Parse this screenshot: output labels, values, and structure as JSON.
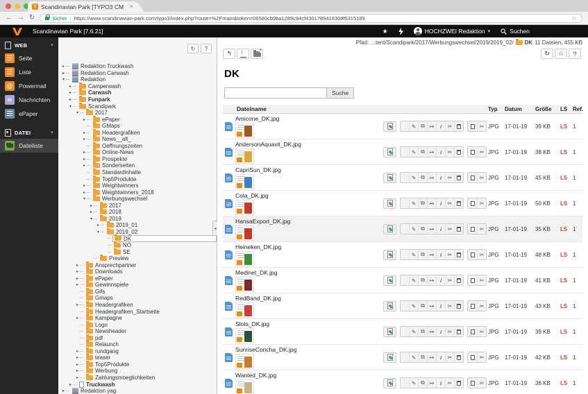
{
  "browser": {
    "tab_title": "Scandinavian Park [TYPO3 CM",
    "security_label": "Sicher",
    "url": "https://www.scandinavian-park.com/typo3/index.php?route=%2Fmain&token=06580cb9ba1289c94cf4301789416308f5315189"
  },
  "topbar": {
    "site_title": "Scandinavian Park [7.6.21]",
    "username": "HOCHZWEI Redaktion",
    "search_label": "Suchen"
  },
  "module_menu": {
    "web_label": "WEB",
    "datei_label": "DATEI",
    "web_items": [
      {
        "label": "Seite",
        "icon": "page-icon",
        "color": "#f48620"
      },
      {
        "label": "Liste",
        "icon": "list-icon",
        "color": "#f48620"
      },
      {
        "label": "Powermail",
        "icon": "at-icon",
        "color": "#f48620"
      },
      {
        "label": "Nachrichten",
        "icon": "news-icon",
        "color": "#a6a7d4"
      },
      {
        "label": "ePaper",
        "icon": "epaper-icon",
        "color": "#6c87a0"
      }
    ],
    "datei_items": [
      {
        "label": "Dateiliste",
        "icon": "filelist-icon",
        "color": "#79a548",
        "active": true
      }
    ]
  },
  "tree": {
    "items": [
      {
        "label": "Redaktion Truckwash",
        "level": 0,
        "arrow": "closed",
        "icon": "storage"
      },
      {
        "label": "Redaktion Carwash",
        "level": 0,
        "arrow": "closed",
        "icon": "storage"
      },
      {
        "label": "Redaktion",
        "level": 0,
        "arrow": "open",
        "icon": "storage"
      },
      {
        "label": "Camperwash",
        "level": 1,
        "arrow": "closed",
        "icon": "folder"
      },
      {
        "label": "Carwash",
        "level": 1,
        "arrow": "closed",
        "icon": "folder",
        "bold": true
      },
      {
        "label": "Funpark",
        "level": 1,
        "arrow": "closed",
        "icon": "folder",
        "bold": true
      },
      {
        "label": "Scandipark",
        "level": 1,
        "arrow": "open",
        "icon": "folder"
      },
      {
        "label": "2017",
        "level": 2,
        "arrow": "open",
        "icon": "folder"
      },
      {
        "label": "ePaper",
        "level": 3,
        "arrow": "closed",
        "icon": "folder"
      },
      {
        "label": "GMaps",
        "level": 3,
        "icon": "folder"
      },
      {
        "label": "Headergrafiken",
        "level": 3,
        "arrow": "closed",
        "icon": "folder"
      },
      {
        "label": "News__alt_",
        "level": 3,
        "arrow": "closed",
        "icon": "folder"
      },
      {
        "label": "Oeffnungszeiten",
        "level": 3,
        "icon": "folder"
      },
      {
        "label": "Online-News",
        "level": 3,
        "arrow": "closed",
        "icon": "folder"
      },
      {
        "label": "Prospekte",
        "level": 3,
        "arrow": "closed",
        "icon": "folder"
      },
      {
        "label": "Sonderseiten",
        "level": 3,
        "arrow": "closed",
        "icon": "folder"
      },
      {
        "label": "Standardinhalte",
        "level": 3,
        "icon": "folder"
      },
      {
        "label": "Top5Produkte",
        "level": 3,
        "icon": "folder"
      },
      {
        "label": "Weightwinners",
        "level": 3,
        "arrow": "closed",
        "icon": "folder"
      },
      {
        "label": "Weightwinners_2018",
        "level": 3,
        "arrow": "closed",
        "icon": "folder"
      },
      {
        "label": "Werbungswechsel",
        "level": 3,
        "arrow": "open",
        "icon": "folder"
      },
      {
        "label": "2017",
        "level": 4,
        "arrow": "closed",
        "icon": "folder"
      },
      {
        "label": "2018",
        "level": 4,
        "arrow": "closed",
        "icon": "folder"
      },
      {
        "label": "2019",
        "level": 4,
        "arrow": "open",
        "icon": "folder"
      },
      {
        "label": "2019_01",
        "level": 5,
        "arrow": "closed",
        "icon": "folder"
      },
      {
        "label": "2019_02",
        "level": 5,
        "arrow": "open",
        "icon": "folder"
      },
      {
        "label": "DK",
        "level": 6,
        "icon": "folder",
        "selected": true
      },
      {
        "label": "NO",
        "level": 6,
        "icon": "folder"
      },
      {
        "label": "SE",
        "level": 6,
        "icon": "folder"
      },
      {
        "label": "Preview",
        "level": 4,
        "icon": "folder"
      },
      {
        "label": "Ansprechpartner",
        "level": 2,
        "arrow": "closed",
        "icon": "folder"
      },
      {
        "label": "Downloads",
        "level": 2,
        "arrow": "closed",
        "icon": "folder"
      },
      {
        "label": "ePaper",
        "level": 2,
        "arrow": "closed",
        "icon": "folder"
      },
      {
        "label": "Gewinnspiele",
        "level": 2,
        "arrow": "closed",
        "icon": "folder"
      },
      {
        "label": "Gifs",
        "level": 2,
        "icon": "folder"
      },
      {
        "label": "Gmaps",
        "level": 2,
        "icon": "folder"
      },
      {
        "label": "Headergrafiken",
        "level": 2,
        "arrow": "closed",
        "icon": "folder"
      },
      {
        "label": "Headergrafiken_Startseite",
        "level": 2,
        "icon": "folder"
      },
      {
        "label": "Kampagne",
        "level": 2,
        "arrow": "closed",
        "icon": "folder"
      },
      {
        "label": "Logo",
        "level": 2,
        "icon": "folder"
      },
      {
        "label": "Newsheader",
        "level": 2,
        "icon": "folder"
      },
      {
        "label": "pdf",
        "level": 2,
        "icon": "folder"
      },
      {
        "label": "Relaunch",
        "level": 2,
        "icon": "folder"
      },
      {
        "label": "rundgang",
        "level": 2,
        "arrow": "closed",
        "icon": "folder"
      },
      {
        "label": "teaser",
        "level": 2,
        "arrow": "closed",
        "icon": "folder"
      },
      {
        "label": "Top5Produkte",
        "level": 2,
        "arrow": "closed",
        "icon": "folder"
      },
      {
        "label": "Werbung",
        "level": 2,
        "arrow": "closed",
        "icon": "folder"
      },
      {
        "label": "Zahlungsmoeglichkeiten",
        "level": 2,
        "arrow": "closed",
        "icon": "folder"
      },
      {
        "label": "Truckwash",
        "level": 1,
        "arrow": "closed",
        "icon": "page",
        "bold": true
      },
      {
        "label": "Redaktion yag",
        "level": 0,
        "arrow": "closed",
        "icon": "storage"
      }
    ]
  },
  "docheader": {
    "path_label": "Pfad:",
    "path_value": "...tent/Scandipark/2017/Werbungswechsel/2019/2019_02/",
    "folder_name": "DK",
    "folder_info": "11 Dateien, 455 KB"
  },
  "content": {
    "title": "DK",
    "search_button": "Suche",
    "columns": {
      "name": "Dateiname",
      "type": "Typ",
      "date": "Datum",
      "size": "Größe",
      "ls": "LS",
      "ref": "Ref."
    },
    "row_action_icons": [
      "view",
      "edit",
      "replace",
      "move",
      "info",
      "cut",
      "delete",
      "copy",
      "cut"
    ],
    "files": [
      {
        "name": "Amicone_DK.jpg",
        "type": "JPG",
        "date": "17-01-19",
        "size": "39 KB",
        "ls": "LS",
        "ref": "1",
        "accent": "#9a5a28"
      },
      {
        "name": "AndersonAquavit_DK.jpg",
        "type": "JPG",
        "date": "17-01-19",
        "size": "38 KB",
        "ls": "LS",
        "ref": "1",
        "accent": "#d9a93f"
      },
      {
        "name": "CapriSun_DK.jpg",
        "type": "JPG",
        "date": "17-01-19",
        "size": "45 KB",
        "ls": "LS",
        "ref": "1",
        "accent": "#3f7fc4"
      },
      {
        "name": "Cola_DK.jpg",
        "type": "JPG",
        "date": "17-01-19",
        "size": "50 KB",
        "ls": "LS",
        "ref": "1",
        "accent": "#c43b2a"
      },
      {
        "name": "HansaExport_DK.jpg",
        "type": "JPG",
        "date": "17-01-19",
        "size": "35 KB",
        "ls": "LS",
        "ref": "1",
        "accent": "#c0392b",
        "highlighted": true
      },
      {
        "name": "Heineken_DK.jpg",
        "type": "JPG",
        "date": "17-01-19",
        "size": "48 KB",
        "ls": "LS",
        "ref": "1",
        "accent": "#3f8f3f"
      },
      {
        "name": "Medinet_DK.jpg",
        "type": "JPG",
        "date": "17-01-19",
        "size": "41 KB",
        "ls": "LS",
        "ref": "1",
        "accent": "#7a2c2c"
      },
      {
        "name": "RedBand_DK.jpg",
        "type": "JPG",
        "date": "17-01-19",
        "size": "43 KB",
        "ls": "LS",
        "ref": "1",
        "accent": "#c84040"
      },
      {
        "name": "Slots_DK.jpg",
        "type": "JPG",
        "date": "17-01-19",
        "size": "39 KB",
        "ls": "LS",
        "ref": "1",
        "accent": "#2f4f3f"
      },
      {
        "name": "SunriseConcha_DK.jpg",
        "type": "JPG",
        "date": "17-01-19",
        "size": "42 KB",
        "ls": "LS",
        "ref": "1",
        "accent": "#c77a2e"
      },
      {
        "name": "Wanted_DK.jpg",
        "type": "JPG",
        "date": "17-01-19",
        "size": "36 KB",
        "ls": "LS",
        "ref": "1",
        "accent": "#c9b28a"
      }
    ]
  },
  "icons": {
    "caret_down": "▾",
    "refresh": "↻",
    "help": "?",
    "star_outline": "☆",
    "star_filled": "★",
    "close": "×",
    "back": "←",
    "forward": "→",
    "reload": "↻",
    "level_up": "↰",
    "sort": "▪",
    "collapse_left": "◂"
  },
  "colors": {
    "accent_orange": "#ff8700",
    "danger_red": "#c83c3c",
    "folder_orange": "#f0a43c",
    "filelist_green": "#79a548"
  }
}
